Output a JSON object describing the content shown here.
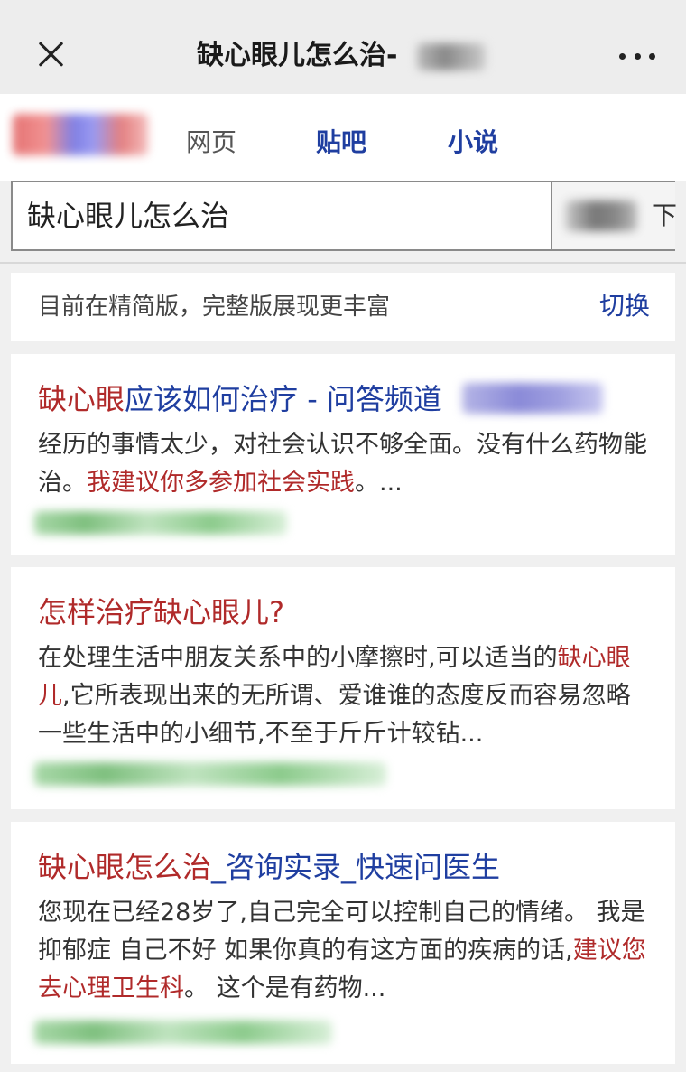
{
  "topbar": {
    "title": "缺心眼儿怎么治-",
    "close_icon": "close-icon",
    "more_icon": "more-dots-icon"
  },
  "nav": {
    "tabs": [
      "网页",
      "贴吧",
      "小说"
    ]
  },
  "search": {
    "query": "缺心眼儿怎么治",
    "button_label": "下"
  },
  "notice": {
    "text": "目前在精简版，完整版展现更丰富",
    "switch_label": "切换"
  },
  "results": [
    {
      "title_hl": "缺心眼",
      "title_rest": "应该如何治疗 - 问答频道",
      "snippet_parts": [
        {
          "text": "经历的事情太少，对社会认识不够全面。没有什么药物能治。",
          "hl": false
        },
        {
          "text": "我建议你多参加社会实践",
          "hl": true
        },
        {
          "text": "。...",
          "hl": false
        }
      ]
    },
    {
      "title_hl": "怎样治疗缺心眼儿?",
      "title_rest": "",
      "snippet_parts": [
        {
          "text": "在处理生活中朋友关系中的小摩擦时,可以适当的",
          "hl": false
        },
        {
          "text": "缺心眼儿",
          "hl": true
        },
        {
          "text": ",它所表现出来的无所谓、爱谁谁的态度反而容易忽略一些生活中的小细节,不至于斤斤计较钻...",
          "hl": false
        }
      ]
    },
    {
      "title_hl": "缺心眼怎么治",
      "title_rest": "_咨询实录_快速问医生",
      "snippet_parts": [
        {
          "text": "您现在已经28岁了,自己完全可以控制自己的情绪。 我是抑郁症 自己不好 如果你真的有这方面的疾病的话,",
          "hl": false
        },
        {
          "text": "建议您去心理卫生科",
          "hl": true
        },
        {
          "text": "。 这个是有药物...",
          "hl": false
        }
      ]
    }
  ],
  "colors": {
    "link_blue": "#1f3ea0",
    "highlight_red": "#b02a2a",
    "background": "#f0f0f0"
  }
}
